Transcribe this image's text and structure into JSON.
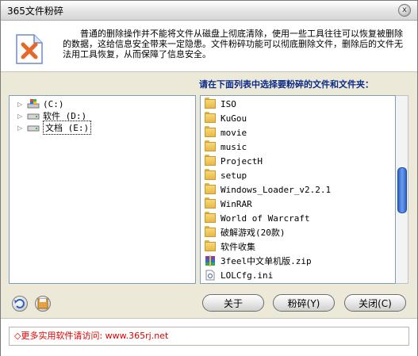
{
  "window": {
    "title": "365文件粉碎",
    "close_glyph": "x"
  },
  "header": {
    "description": "普通的删除操作并不能将文件从磁盘上彻底清除，使用一些工具往往可以恢复被删除的数据，这给信息安全带来一定隐患。文件粉碎功能可以彻底删除文件，删除后的文件无法用工具恢复，从而保障了信息安全。"
  },
  "instruction": "请在下面列表中选择要粉碎的文件和文件夹：",
  "drives": [
    {
      "label": "(C:)"
    },
    {
      "label": "软件 (D:)"
    },
    {
      "label": "文档 (E:)"
    }
  ],
  "files": [
    {
      "name": "ISO",
      "type": "folder"
    },
    {
      "name": "KuGou",
      "type": "folder"
    },
    {
      "name": "movie",
      "type": "folder"
    },
    {
      "name": "music",
      "type": "folder"
    },
    {
      "name": "ProjectH",
      "type": "folder"
    },
    {
      "name": "setup",
      "type": "folder"
    },
    {
      "name": "Windows_Loader_v2.2.1",
      "type": "folder"
    },
    {
      "name": "WinRAR",
      "type": "folder"
    },
    {
      "name": "World of Warcraft",
      "type": "folder"
    },
    {
      "name": "破解游戏(20款)",
      "type": "folder"
    },
    {
      "name": "软件收集",
      "type": "folder"
    },
    {
      "name": "3feel中文单机版.zip",
      "type": "archive"
    },
    {
      "name": "LOLCfg.ini",
      "type": "ini"
    }
  ],
  "buttons": {
    "about": "关于",
    "shred": "粉碎(Y)",
    "close": "关闭(C)"
  },
  "footer": {
    "promo": "◇更多实用软件请访问: www.365rj.net"
  },
  "colors": {
    "accent": "#0a2a8c",
    "promo": "#e00000",
    "scroll_thumb": "#2b63c5"
  }
}
